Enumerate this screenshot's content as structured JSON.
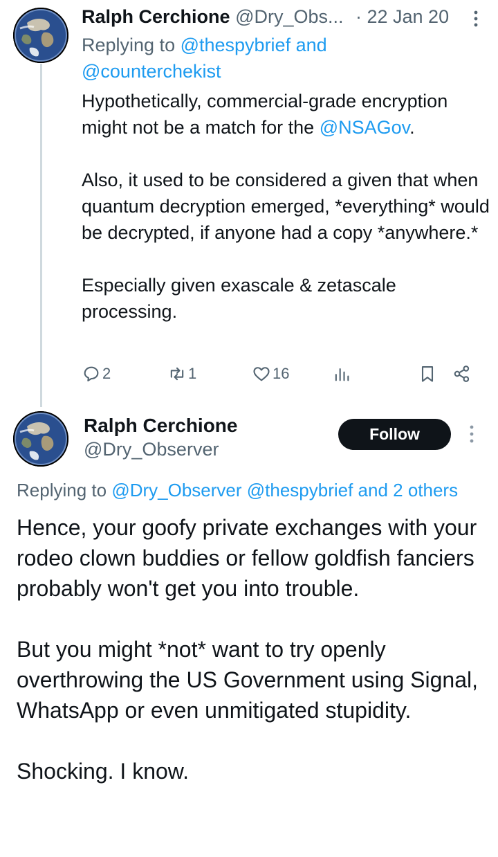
{
  "parent_tweet": {
    "author_name": "Ralph Cerchione",
    "handle": "@Dry_Obs...",
    "date": "· 22 Jan 20",
    "replying_prefix": "Replying to ",
    "replying_to": [
      "@thespybrief and",
      "@counterchekist"
    ],
    "body": {
      "line1_text": "Hypothetically, commercial-grade encryption might not be a match for the ",
      "line1_mention": "@NSAGov",
      "line1_end": ".",
      "para2": "Also, it used to be considered a given that when quantum decryption emerged, *everything* would be decrypted, if anyone had a copy *anywhere.*",
      "para3": "Especially given exascale & zetascale processing."
    },
    "actions": {
      "replies": "2",
      "reposts": "1",
      "likes": "16"
    }
  },
  "main_tweet": {
    "author_name": "Ralph Cerchione",
    "handle": "@Dry_Observer",
    "follow_label": "Follow",
    "replying_prefix": "Replying to ",
    "replying_mentions": "@Dry_Observer @thespybrief and 2 others",
    "body": {
      "para1": "Hence, your goofy private exchanges with your rodeo clown buddies or fellow goldfish fanciers probably won't get you into trouble.",
      "para2": "But you might *not* want to try openly overthrowing the US Government using Signal, WhatsApp or even unmitigated stupidity.",
      "para3": "Shocking. I know."
    }
  },
  "colors": {
    "text": "#0f1419",
    "secondary": "#536471",
    "link": "#1d9bf0",
    "thread_line": "#cfd9de",
    "follow_bg": "#0f1419"
  },
  "icons": [
    "earth-avatar",
    "more-icon",
    "reply-icon",
    "repost-icon",
    "like-icon",
    "views-icon",
    "bookmark-icon",
    "share-icon"
  ]
}
